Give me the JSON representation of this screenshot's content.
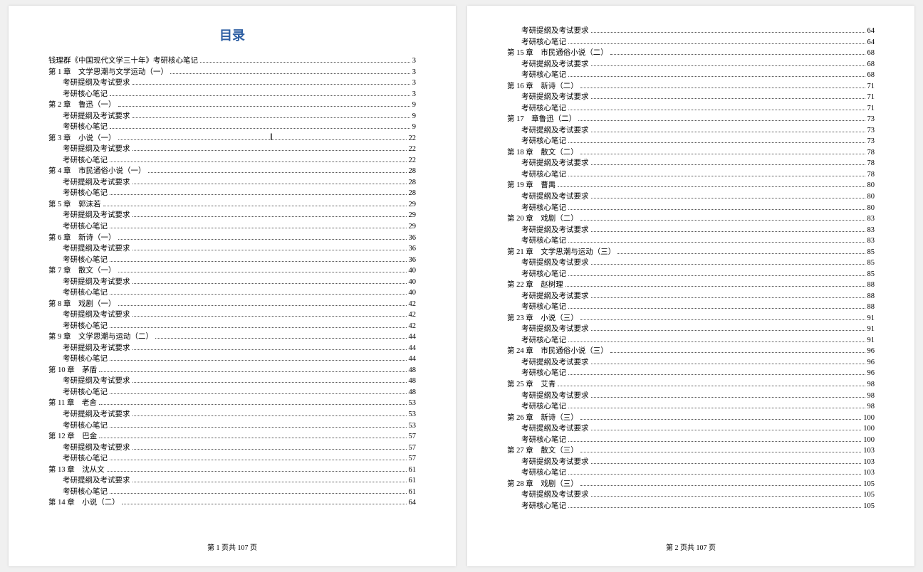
{
  "title": "目录",
  "footer_page1": "第 1 页共 107 页",
  "footer_page2": "第 2 页共 107 页",
  "page1": [
    {
      "label": "钱理群《中国现代文学三十年》考研核心笔记",
      "pg": "3",
      "indent": 0
    },
    {
      "label": "第 1 章　文学思潮与文学运动（一）",
      "pg": "3",
      "indent": 0
    },
    {
      "label": "考研提纲及考试要求",
      "pg": "3",
      "indent": 1
    },
    {
      "label": "考研核心笔记",
      "pg": "3",
      "indent": 1
    },
    {
      "label": "第 2 章　鲁迅（一）",
      "pg": "9",
      "indent": 0
    },
    {
      "label": "考研提纲及考试要求",
      "pg": "9",
      "indent": 1
    },
    {
      "label": "考研核心笔记",
      "pg": "9",
      "indent": 1
    },
    {
      "label": "第 3 章　小说（一）",
      "pg": "22",
      "indent": 0
    },
    {
      "label": "考研提纲及考试要求",
      "pg": "22",
      "indent": 1
    },
    {
      "label": "考研核心笔记",
      "pg": "22",
      "indent": 1
    },
    {
      "label": "第 4 章　市民通俗小说（一）",
      "pg": "28",
      "indent": 0
    },
    {
      "label": "考研提纲及考试要求",
      "pg": "28",
      "indent": 1
    },
    {
      "label": "考研核心笔记",
      "pg": "28",
      "indent": 1
    },
    {
      "label": "第 5 章　郭沫若",
      "pg": "29",
      "indent": 0
    },
    {
      "label": "考研提纲及考试要求",
      "pg": "29",
      "indent": 1
    },
    {
      "label": "考研核心笔记",
      "pg": "29",
      "indent": 1
    },
    {
      "label": "第 6 章　新诗（一）",
      "pg": "36",
      "indent": 0
    },
    {
      "label": "考研提纲及考试要求",
      "pg": "36",
      "indent": 1
    },
    {
      "label": "考研核心笔记",
      "pg": "36",
      "indent": 1
    },
    {
      "label": "第 7 章　散文（一）",
      "pg": "40",
      "indent": 0
    },
    {
      "label": "考研提纲及考试要求",
      "pg": "40",
      "indent": 1
    },
    {
      "label": "考研核心笔记",
      "pg": "40",
      "indent": 1
    },
    {
      "label": "第 8 章　戏剧（一）",
      "pg": "42",
      "indent": 0
    },
    {
      "label": "考研提纲及考试要求",
      "pg": "42",
      "indent": 1
    },
    {
      "label": "考研核心笔记",
      "pg": "42",
      "indent": 1
    },
    {
      "label": "第 9 章　文学思潮与运动（二）",
      "pg": "44",
      "indent": 0
    },
    {
      "label": "考研提纲及考试要求",
      "pg": "44",
      "indent": 1
    },
    {
      "label": "考研核心笔记",
      "pg": "44",
      "indent": 1
    },
    {
      "label": "第 10 章　茅盾",
      "pg": "48",
      "indent": 0
    },
    {
      "label": "考研提纲及考试要求",
      "pg": "48",
      "indent": 1
    },
    {
      "label": "考研核心笔记",
      "pg": "48",
      "indent": 1
    },
    {
      "label": "第 11 章　老舍",
      "pg": "53",
      "indent": 0
    },
    {
      "label": "考研提纲及考试要求",
      "pg": "53",
      "indent": 1
    },
    {
      "label": "考研核心笔记",
      "pg": "53",
      "indent": 1
    },
    {
      "label": "第 12 章　巴金",
      "pg": "57",
      "indent": 0
    },
    {
      "label": "考研提纲及考试要求",
      "pg": "57",
      "indent": 1
    },
    {
      "label": "考研核心笔记",
      "pg": "57",
      "indent": 1
    },
    {
      "label": "第 13 章　沈从文",
      "pg": "61",
      "indent": 0
    },
    {
      "label": "考研提纲及考试要求",
      "pg": "61",
      "indent": 1
    },
    {
      "label": "考研核心笔记",
      "pg": "61",
      "indent": 1
    },
    {
      "label": "第 14 章　小说（二）",
      "pg": "64",
      "indent": 0
    }
  ],
  "page2": [
    {
      "label": "考研提纲及考试要求",
      "pg": "64",
      "indent": 1
    },
    {
      "label": "考研核心笔记",
      "pg": "64",
      "indent": 1
    },
    {
      "label": "第 15 章　市民通俗小说（二）",
      "pg": "68",
      "indent": 0
    },
    {
      "label": "考研提纲及考试要求",
      "pg": "68",
      "indent": 1
    },
    {
      "label": "考研核心笔记",
      "pg": "68",
      "indent": 1
    },
    {
      "label": "第 16 章　新诗（二）",
      "pg": "71",
      "indent": 0
    },
    {
      "label": "考研提纲及考试要求",
      "pg": "71",
      "indent": 1
    },
    {
      "label": "考研核心笔记",
      "pg": "71",
      "indent": 1
    },
    {
      "label": "第 17　章鲁迅（二）",
      "pg": "73",
      "indent": 0
    },
    {
      "label": "考研提纲及考试要求",
      "pg": "73",
      "indent": 1
    },
    {
      "label": "考研核心笔记",
      "pg": "73",
      "indent": 1
    },
    {
      "label": "第 18 章　散文（二）",
      "pg": "78",
      "indent": 0
    },
    {
      "label": "考研提纲及考试要求",
      "pg": "78",
      "indent": 1
    },
    {
      "label": "考研核心笔记",
      "pg": "78",
      "indent": 1
    },
    {
      "label": "第 19 章　曹禺",
      "pg": "80",
      "indent": 0
    },
    {
      "label": "考研提纲及考试要求",
      "pg": "80",
      "indent": 1
    },
    {
      "label": "考研核心笔记",
      "pg": "80",
      "indent": 1
    },
    {
      "label": "第 20 章　戏剧（二）",
      "pg": "83",
      "indent": 0
    },
    {
      "label": "考研提纲及考试要求",
      "pg": "83",
      "indent": 1
    },
    {
      "label": "考研核心笔记",
      "pg": "83",
      "indent": 1
    },
    {
      "label": "第 21 章　文学思潮与运动（三）",
      "pg": "85",
      "indent": 0
    },
    {
      "label": "考研提纲及考试要求",
      "pg": "85",
      "indent": 1
    },
    {
      "label": "考研核心笔记",
      "pg": "85",
      "indent": 1
    },
    {
      "label": "第 22 章　赵树理",
      "pg": "88",
      "indent": 0
    },
    {
      "label": "考研提纲及考试要求",
      "pg": "88",
      "indent": 1
    },
    {
      "label": "考研核心笔记",
      "pg": "88",
      "indent": 1
    },
    {
      "label": "第 23 章　小说（三）",
      "pg": "91",
      "indent": 0
    },
    {
      "label": "考研提纲及考试要求",
      "pg": "91",
      "indent": 1
    },
    {
      "label": "考研核心笔记",
      "pg": "91",
      "indent": 1
    },
    {
      "label": "第 24 章　市民通俗小说（三）",
      "pg": "96",
      "indent": 0
    },
    {
      "label": "考研提纲及考试要求",
      "pg": "96",
      "indent": 1
    },
    {
      "label": "考研核心笔记",
      "pg": "96",
      "indent": 1
    },
    {
      "label": "第 25 章　艾青",
      "pg": "98",
      "indent": 0
    },
    {
      "label": "考研提纲及考试要求",
      "pg": "98",
      "indent": 1
    },
    {
      "label": "考研核心笔记",
      "pg": "98",
      "indent": 1
    },
    {
      "label": "第 26 章　新诗（三）",
      "pg": "100",
      "indent": 0
    },
    {
      "label": "考研提纲及考试要求",
      "pg": "100",
      "indent": 1
    },
    {
      "label": "考研核心笔记",
      "pg": "100",
      "indent": 1
    },
    {
      "label": "第 27 章　散文（三）",
      "pg": "103",
      "indent": 0
    },
    {
      "label": "考研提纲及考试要求",
      "pg": "103",
      "indent": 1
    },
    {
      "label": "考研核心笔记",
      "pg": "103",
      "indent": 1
    },
    {
      "label": "第 28 章　戏剧（三）",
      "pg": "105",
      "indent": 0
    },
    {
      "label": "考研提纲及考试要求",
      "pg": "105",
      "indent": 1
    },
    {
      "label": "考研核心笔记",
      "pg": "105",
      "indent": 1
    }
  ]
}
